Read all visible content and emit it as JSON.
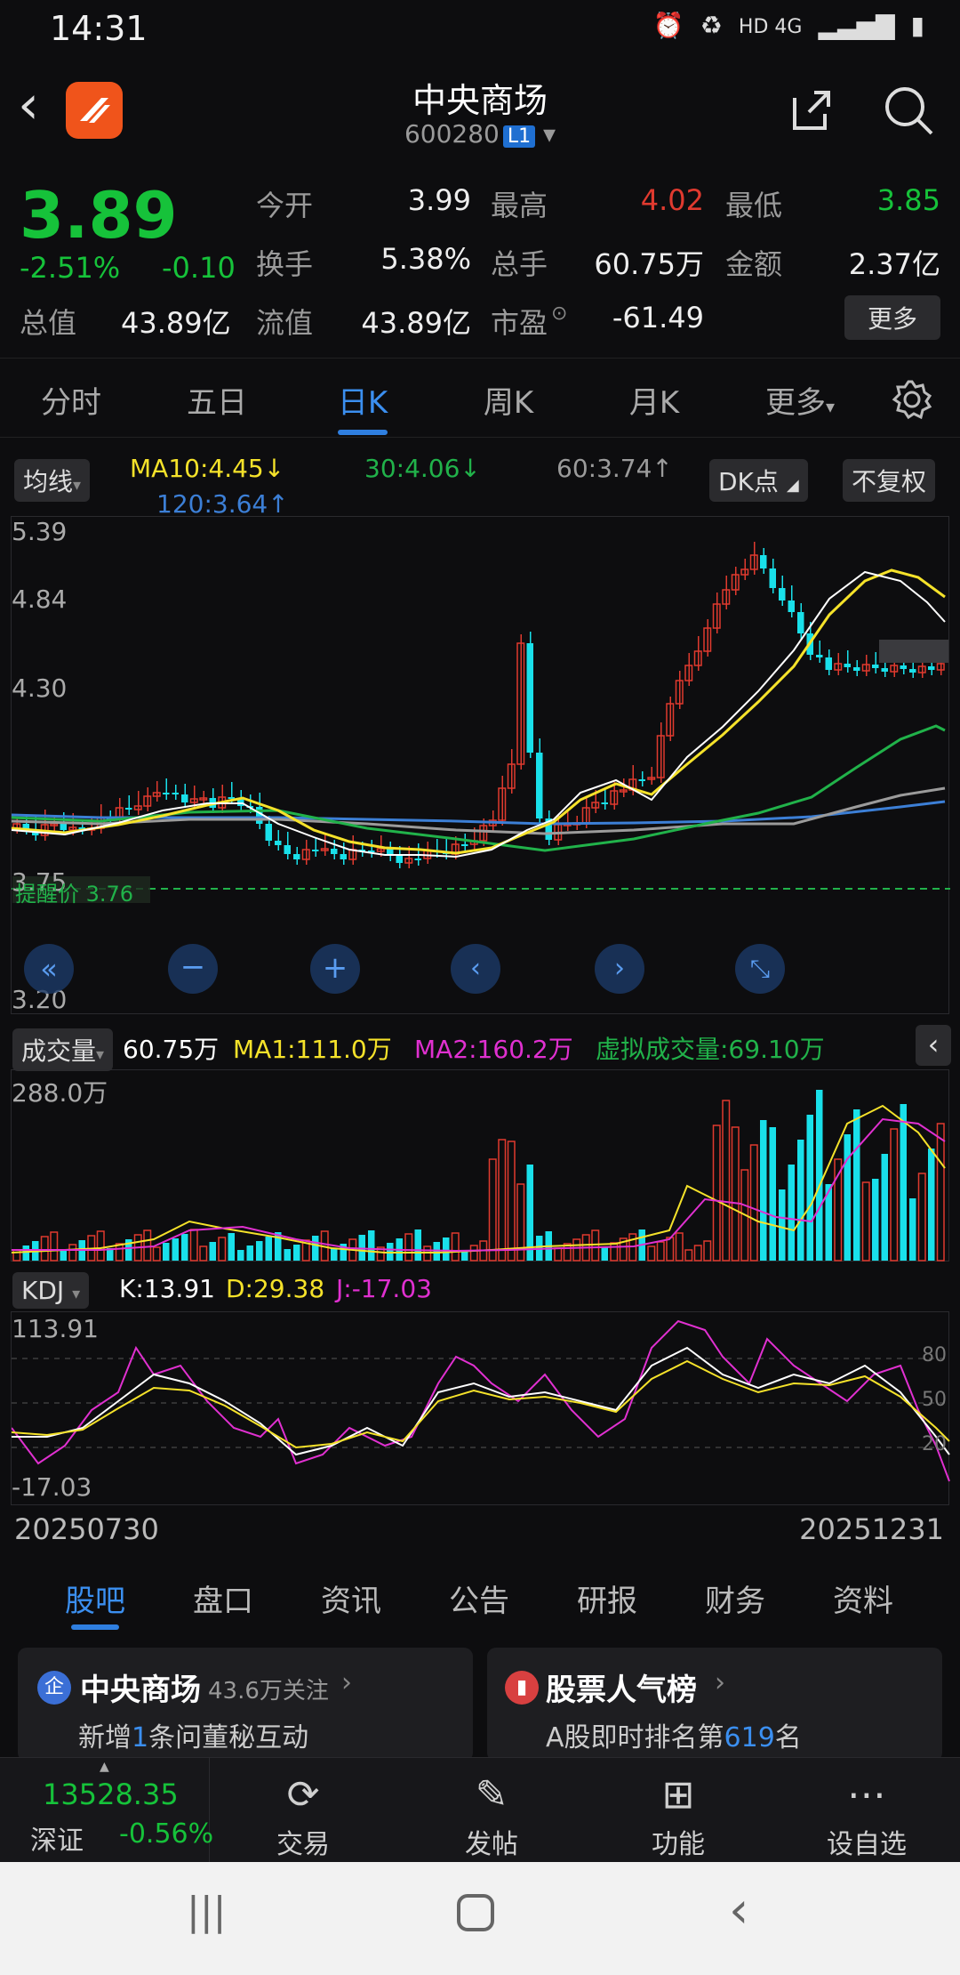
{
  "status": {
    "time": "14:31",
    "network": "HD 4G"
  },
  "header": {
    "title": "中央商场",
    "code": "600280",
    "level": "L1"
  },
  "quote": {
    "price": "3.89",
    "pct": "-2.51%",
    "chg": "-0.10",
    "open_label": "今开",
    "open": "3.99",
    "high_label": "最高",
    "high": "4.02",
    "low_label": "最低",
    "low": "3.85",
    "turnover_label": "换手",
    "turnover": "5.38%",
    "volume_label": "总手",
    "volume": "60.75万",
    "amount_label": "金额",
    "amount": "2.37亿",
    "total_label": "总值",
    "total": "43.89亿",
    "float_label": "流值",
    "float": "43.89亿",
    "pe_label": "市盈",
    "pe": "-61.49",
    "more": "更多"
  },
  "tabs": [
    "分时",
    "五日",
    "日K",
    "周K",
    "月K",
    "更多"
  ],
  "chart": {
    "ma_btn": "均线",
    "ma10": "MA10:4.45↓",
    "ma30": "30:4.06↓",
    "ma60": "60:3.74↑",
    "ma120": "120:3.64↑",
    "dk_btn": "DK点",
    "fq_btn": "不复权",
    "y_labels": [
      "5.39",
      "4.84",
      "4.30",
      "3.75",
      "3.20"
    ],
    "alert_text": "提醒价 3.76",
    "colors": {
      "up": "#e03a2f",
      "down": "#19e0ea",
      "ma5": "#ffffff",
      "ma10": "#f5e22a",
      "ma30": "#21b24a",
      "ma60": "#9b9b9b",
      "ma120": "#3c7fd6"
    }
  },
  "volume": {
    "btn": "成交量",
    "vol": "60.75万",
    "ma1": "MA1:111.0万",
    "ma2": "MA2:160.2万",
    "virtual": "虚拟成交量:69.10万",
    "top_label": "288.0万"
  },
  "kdj": {
    "btn": "KDJ",
    "k": "K:13.91",
    "d": "D:29.38",
    "j": "J:-17.03",
    "top": "113.91",
    "bottom": "-17.03",
    "levels": [
      "80",
      "50",
      "20"
    ]
  },
  "dates": {
    "start": "20250730",
    "end": "20251231"
  },
  "subtabs": [
    "股吧",
    "盘口",
    "资讯",
    "公告",
    "研报",
    "财务",
    "资料"
  ],
  "cards": {
    "left_title": "中央商场",
    "left_follow": "43.6万关注",
    "left_line_pre": "新增",
    "left_line_num": "1",
    "left_line_post": "条问董秘互动",
    "right_title": "股票人气榜",
    "right_line_pre": "A股即时排名第",
    "right_line_num": "619",
    "right_line_post": "名"
  },
  "bottom": {
    "index_value": "13528.35",
    "index_name": "深证",
    "index_pct": "-0.56%",
    "items": [
      "交易",
      "发帖",
      "功能",
      "设自选"
    ]
  }
}
